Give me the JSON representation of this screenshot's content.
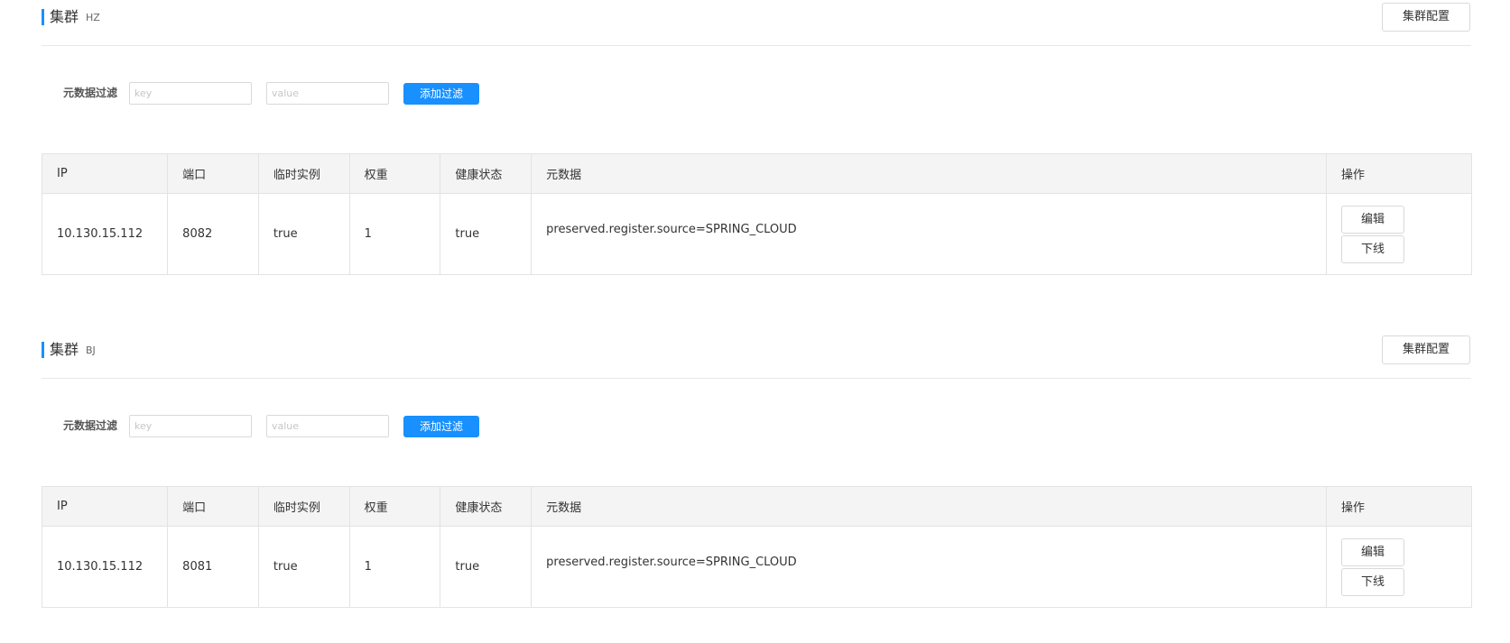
{
  "clusters": [
    {
      "title": "集群",
      "name": "HZ",
      "config_button": "集群配置",
      "filter": {
        "label": "元数据过滤",
        "key_placeholder": "key",
        "value_placeholder": "value",
        "add_button": "添加过滤"
      },
      "columns": [
        "IP",
        "端口",
        "临时实例",
        "权重",
        "健康状态",
        "元数据",
        "操作"
      ],
      "rows": [
        {
          "ip": "10.130.15.112",
          "port": "8082",
          "ephemeral": "true",
          "weight": "1",
          "healthy": "true",
          "metadata": "preserved.register.source=SPRING_CLOUD",
          "edit": "编辑",
          "offline": "下线"
        }
      ]
    },
    {
      "title": "集群",
      "name": "BJ",
      "config_button": "集群配置",
      "filter": {
        "label": "元数据过滤",
        "key_placeholder": "key",
        "value_placeholder": "value",
        "add_button": "添加过滤"
      },
      "columns": [
        "IP",
        "端口",
        "临时实例",
        "权重",
        "健康状态",
        "元数据",
        "操作"
      ],
      "rows": [
        {
          "ip": "10.130.15.112",
          "port": "8081",
          "ephemeral": "true",
          "weight": "1",
          "healthy": "true",
          "metadata": "preserved.register.source=SPRING_CLOUD",
          "edit": "编辑",
          "offline": "下线"
        }
      ]
    }
  ],
  "colors": {
    "accent": "#1890ff",
    "header_bg": "#f4f4f4",
    "border": "#e3e3e3"
  }
}
